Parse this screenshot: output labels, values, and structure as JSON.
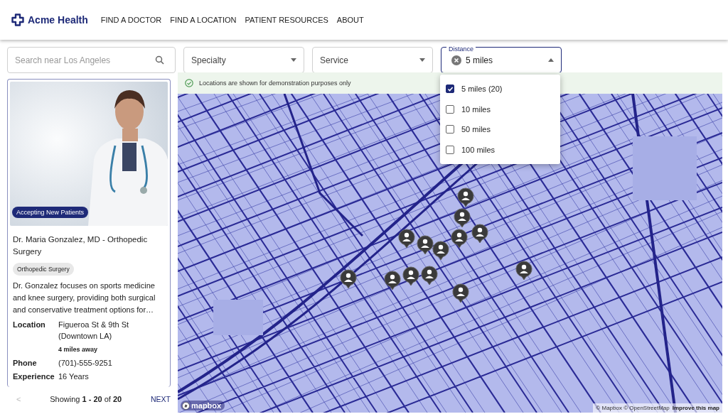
{
  "header": {
    "logo": "Acme Health",
    "nav": [
      "FIND A DOCTOR",
      "FIND A LOCATION",
      "PATIENT RESOURCES",
      "ABOUT"
    ]
  },
  "filters": {
    "search": {
      "placeholder": "Search near Los Angeles"
    },
    "selects": [
      {
        "label": "Specialty"
      },
      {
        "label": "Service"
      }
    ],
    "distance": {
      "label": "Distance",
      "value": "5 miles",
      "expanded": true,
      "options": [
        {
          "label": "5 miles (20)",
          "checked": true
        },
        {
          "label": "10 miles",
          "checked": false
        },
        {
          "label": "50 miles",
          "checked": false
        },
        {
          "label": "100 miles",
          "checked": false
        }
      ]
    }
  },
  "doctor": {
    "badge": "Accepting New Patients",
    "name": "Dr. Maria Gonzalez, MD - Orthopedic Surgery",
    "tag": "Orthopedic Surgery",
    "description": "Dr. Gonzalez focuses on sports medicine and knee surgery, providing both surgical and conservative treatment options for…",
    "details": [
      {
        "label": "Location",
        "value": "Figueroa St & 9th St (Downtown LA)",
        "note": "4 miles away"
      },
      {
        "label": "Phone",
        "value": "(701)-555-9251"
      },
      {
        "label": "Experience",
        "value": "16 Years"
      }
    ]
  },
  "pagination": {
    "prev": "<",
    "prev_disabled": true,
    "summary": "Showing **1 - 20** of **20**",
    "next": "NEXT"
  },
  "map": {
    "notice": "Locations are shown for demonstration purposes only",
    "logo": "mapbox",
    "attribution": "© Mapbox © OpenStreetMap",
    "improve": "Improve this map"
  }
}
